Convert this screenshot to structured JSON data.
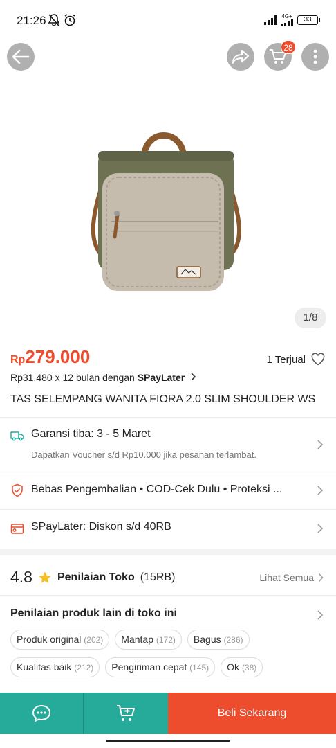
{
  "status_bar": {
    "time": "21:26",
    "network": "4G+",
    "battery": "33"
  },
  "header": {
    "cart_count": "28"
  },
  "gallery": {
    "pager": "1/8"
  },
  "product": {
    "currency": "Rp",
    "price": "279.000",
    "sold": "1 Terjual",
    "installment_text": "Rp31.480 x 12 bulan dengan ",
    "installment_brand": "SPayLater",
    "title": "TAS SELEMPANG WANITA FIORA 2.0 SLIM SHOULDER WS"
  },
  "shipping": {
    "label": "Garansi tiba: 3 - 5 Maret",
    "note": "Dapatkan Voucher s/d Rp10.000 jika pesanan terlambat."
  },
  "services": {
    "label": "Bebas Pengembalian  •  COD-Cek Dulu  •  Proteksi ..."
  },
  "spaylater": {
    "label": "SPayLater: Diskon s/d 40RB"
  },
  "shop_rating": {
    "score": "4.8",
    "label": "Penilaian Toko",
    "count": "(15RB)",
    "see_all": "Lihat Semua"
  },
  "other_ratings": {
    "title": "Penilaian produk lain di toko ini",
    "chips": [
      {
        "label": "Produk original",
        "count": "(202)"
      },
      {
        "label": "Mantap",
        "count": "(172)"
      },
      {
        "label": "Bagus",
        "count": "(286)"
      },
      {
        "label": "Kualitas baik",
        "count": "(212)"
      },
      {
        "label": "Pengiriman cepat",
        "count": "(145)"
      },
      {
        "label": "Ok",
        "count": "(38)"
      }
    ]
  },
  "bottom_bar": {
    "buy_label": "Beli Sekarang"
  },
  "colors": {
    "accent": "#ee4d2d",
    "teal": "#26aa99"
  }
}
